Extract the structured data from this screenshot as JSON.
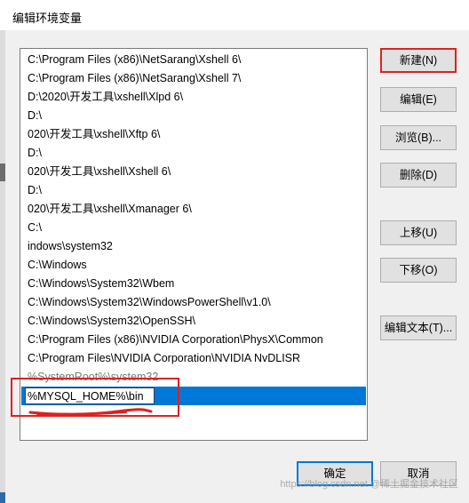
{
  "window": {
    "title": "编辑环境变量"
  },
  "list": {
    "items": [
      {
        "text": "C:\\Program Files (x86)\\NetSarang\\Xshell 6\\",
        "faded": false
      },
      {
        "text": "C:\\Program Files (x86)\\NetSarang\\Xshell 7\\",
        "faded": false
      },
      {
        "text": "D:\\2020\\开发工具\\xshell\\Xlpd 6\\",
        "faded": false
      },
      {
        "text": "D:\\",
        "faded": false
      },
      {
        "text": "020\\开发工具\\xshell\\Xftp 6\\",
        "faded": false
      },
      {
        "text": "D:\\",
        "faded": false
      },
      {
        "text": "020\\开发工具\\xshell\\Xshell 6\\",
        "faded": false
      },
      {
        "text": "D:\\",
        "faded": false
      },
      {
        "text": "020\\开发工具\\xshell\\Xmanager 6\\",
        "faded": false
      },
      {
        "text": "C:\\",
        "faded": false
      },
      {
        "text": "indows\\system32",
        "faded": false
      },
      {
        "text": "C:\\Windows",
        "faded": false
      },
      {
        "text": "C:\\Windows\\System32\\Wbem",
        "faded": false
      },
      {
        "text": "C:\\Windows\\System32\\WindowsPowerShell\\v1.0\\",
        "faded": false
      },
      {
        "text": "C:\\Windows\\System32\\OpenSSH\\",
        "faded": false
      },
      {
        "text": "C:\\Program Files (x86)\\NVIDIA Corporation\\PhysX\\Common",
        "faded": false
      },
      {
        "text": "C:\\Program Files\\NVIDIA Corporation\\NVIDIA NvDLISR",
        "faded": false
      },
      {
        "text": "%SystemRoot%\\system32",
        "faded": true
      }
    ],
    "editing_value": "%MYSQL_HOME%\\bin"
  },
  "buttons": {
    "new": "新建(N)",
    "edit": "编辑(E)",
    "browse": "浏览(B)...",
    "delete": "删除(D)",
    "move_up": "上移(U)",
    "move_down": "下移(O)",
    "edit_text": "编辑文本(T)...",
    "ok": "确定",
    "cancel": "取消"
  },
  "watermark": "https://blog.csdn.net @稀土掘金技术社区",
  "colors": {
    "selection": "#0078d7",
    "annotation": "#e02020"
  }
}
